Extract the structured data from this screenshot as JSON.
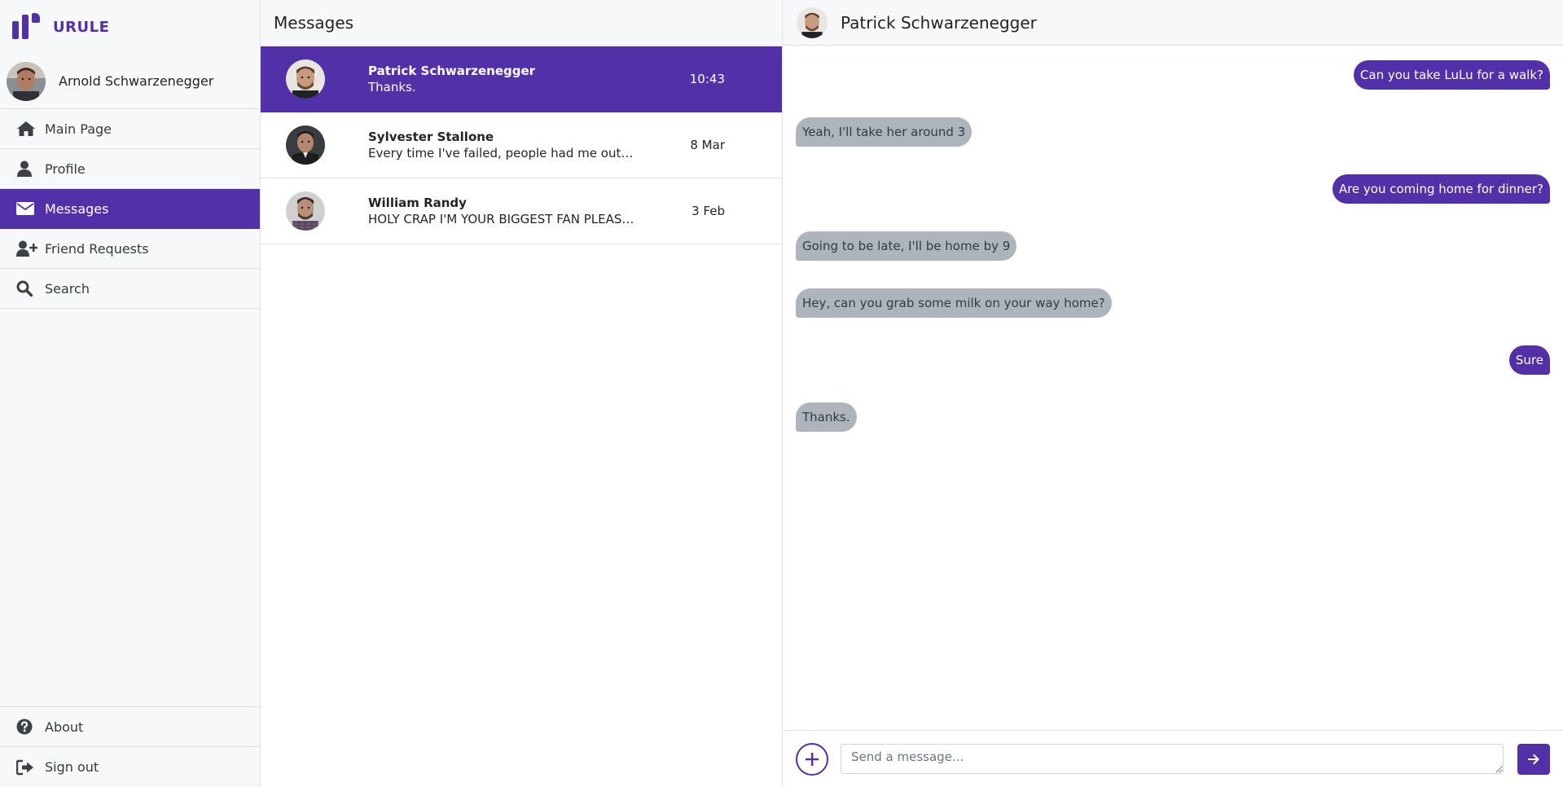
{
  "brand": {
    "name": "URULE",
    "logo_icon": "bars-logo-icon",
    "accent": "#5230a8"
  },
  "user": {
    "name": "Arnold Schwarzenegger"
  },
  "nav": {
    "items": [
      {
        "label": "Main Page",
        "icon": "home-icon"
      },
      {
        "label": "Profile",
        "icon": "user-icon"
      },
      {
        "label": "Messages",
        "icon": "envelope-icon",
        "active": true
      },
      {
        "label": "Friend Requests",
        "icon": "user-plus-icon"
      },
      {
        "label": "Search",
        "icon": "search-icon"
      }
    ],
    "bottom": [
      {
        "label": "About",
        "icon": "question-circle-icon"
      },
      {
        "label": "Sign out",
        "icon": "sign-out-icon"
      }
    ]
  },
  "conversations": {
    "title": "Messages",
    "items": [
      {
        "name": "Patrick Schwarzenegger",
        "preview": "Thanks.",
        "time": "10:43",
        "active": true
      },
      {
        "name": "Sylvester Stallone",
        "preview": "Every time I've failed, people had me out for...",
        "time": "8 Mar"
      },
      {
        "name": "William Randy",
        "preview": "HOLY CRAP I'M YOUR BIGGEST FAN PLEASE ...",
        "time": "3 Feb"
      }
    ]
  },
  "chat": {
    "contact": "Patrick Schwarzenegger",
    "messages": [
      {
        "text": "Can you take LuLu for a walk?",
        "dir": "out"
      },
      {
        "text": "Yeah, I'll take her around 3",
        "dir": "in"
      },
      {
        "text": "Are you coming home for dinner?",
        "dir": "out"
      },
      {
        "text": "Going to be late, I'll be home by 9",
        "dir": "in"
      },
      {
        "text": "Hey, can you grab some milk on your way home?",
        "dir": "in"
      },
      {
        "text": "Sure",
        "dir": "out"
      },
      {
        "text": "Thanks.",
        "dir": "in"
      }
    ],
    "input": {
      "placeholder": "Send a message...",
      "value": ""
    }
  }
}
